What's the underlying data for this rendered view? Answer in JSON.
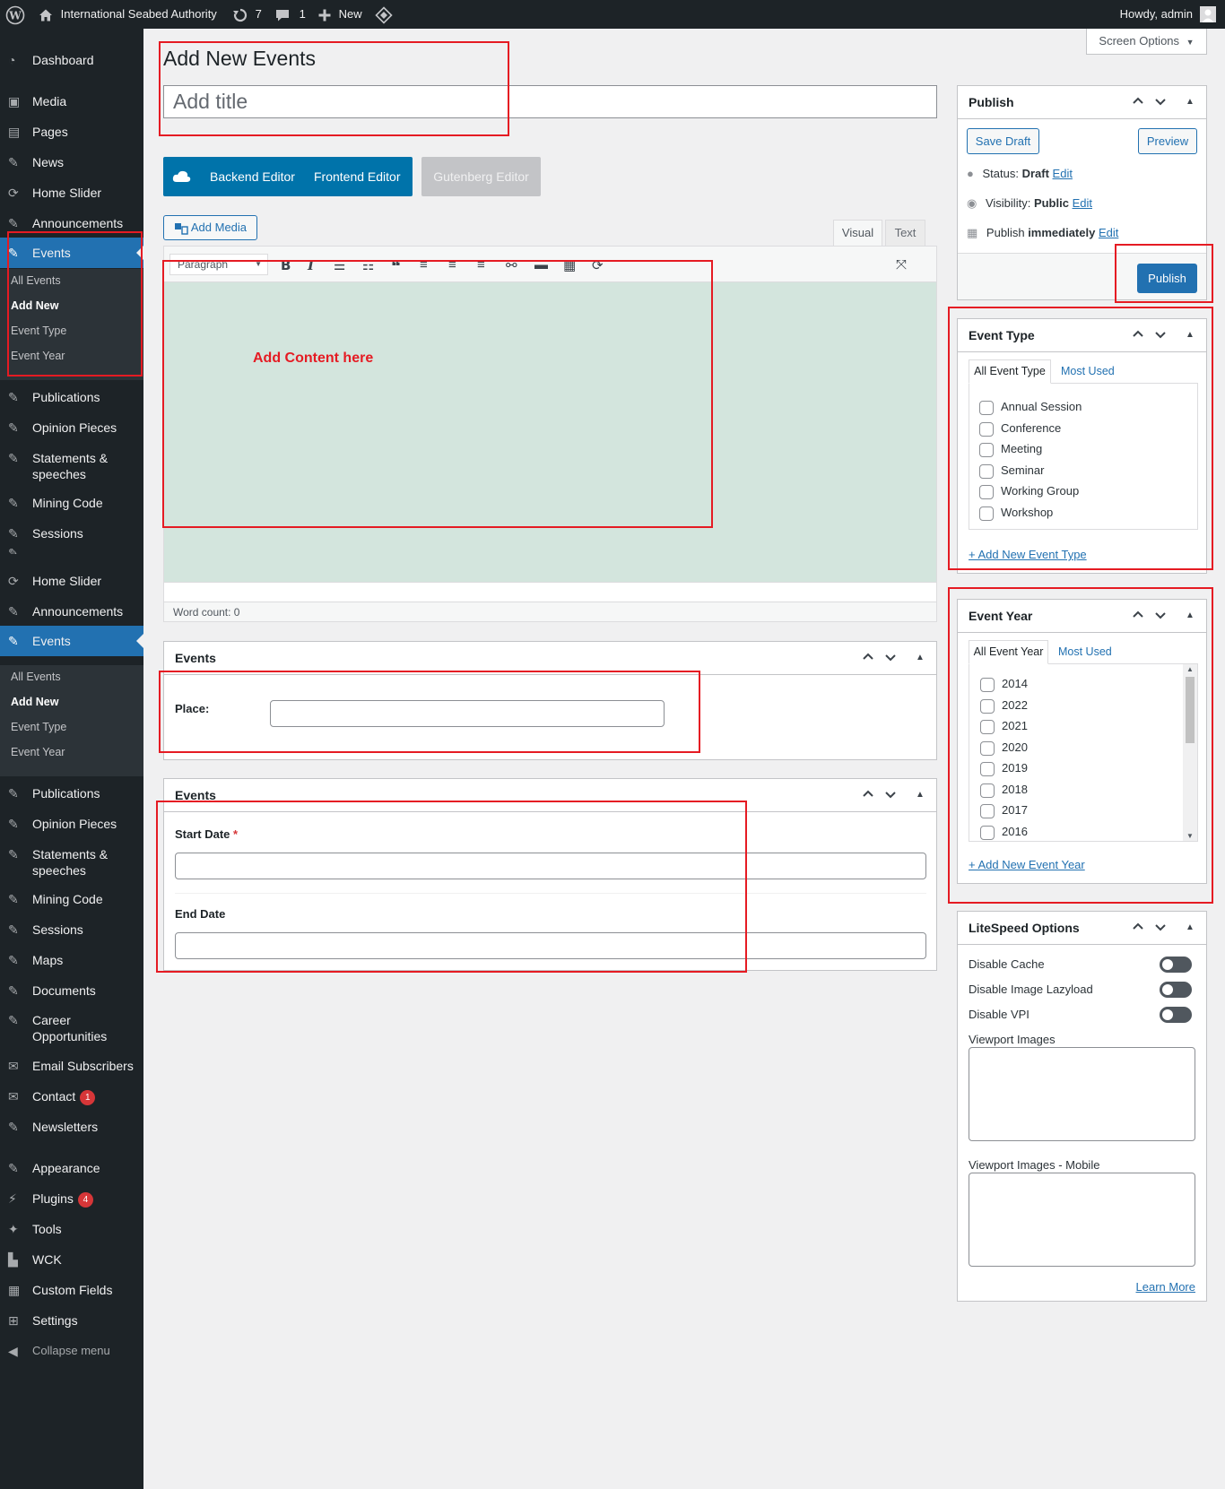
{
  "adminbar": {
    "site_name": "International Seabed Authority",
    "updates_count": "7",
    "comments_count": "1",
    "new_label": "New",
    "howdy": "Howdy, admin"
  },
  "sidebar": {
    "items_top": [
      {
        "label": "Dashboard",
        "icon": "dashboard-icon"
      },
      {
        "label": "Media",
        "icon": "media-icon"
      },
      {
        "label": "Pages",
        "icon": "pages-icon"
      },
      {
        "label": "News",
        "icon": "pin-icon"
      },
      {
        "label": "Home Slider",
        "icon": "slider-icon"
      },
      {
        "label": "Announcements",
        "icon": "pin-icon"
      },
      {
        "label": "Events",
        "icon": "pin-icon"
      }
    ],
    "events_sub": [
      "All Events",
      "Add New",
      "Event Type",
      "Event Year"
    ],
    "items_mid": [
      {
        "label": "Publications"
      },
      {
        "label": "Opinion Pieces"
      },
      {
        "label": "Statements &",
        "label2": "speeches"
      },
      {
        "label": "Mining Code"
      },
      {
        "label": "Sessions"
      }
    ],
    "items_repeat": [
      {
        "label": "Home Slider"
      },
      {
        "label": "Announcements"
      },
      {
        "label": "Events"
      }
    ],
    "items_bottom": [
      {
        "label": "Publications"
      },
      {
        "label": "Opinion Pieces"
      },
      {
        "label": "Statements &",
        "label2": "speeches"
      },
      {
        "label": "Mining Code"
      },
      {
        "label": "Sessions"
      },
      {
        "label": "Maps"
      },
      {
        "label": "Documents"
      },
      {
        "label": "Career",
        "label2": "Opportunities"
      },
      {
        "label": "Email Subscribers"
      },
      {
        "label": "Contact",
        "badge": "1"
      },
      {
        "label": "Newsletters"
      },
      {
        "label": "Appearance"
      },
      {
        "label": "Plugins",
        "badge": "4"
      },
      {
        "label": "Tools"
      },
      {
        "label": "WCK"
      },
      {
        "label": "Custom Fields"
      },
      {
        "label": "Settings"
      },
      {
        "label": "Collapse menu"
      }
    ]
  },
  "screen_options": "Screen Options",
  "page_title": "Add New Events",
  "title_placeholder": "Add title",
  "editor_buttons": {
    "backend": "Backend Editor",
    "frontend": "Frontend Editor",
    "gutenberg": "Gutenberg Editor"
  },
  "add_media": "Add Media",
  "tabs": {
    "visual": "Visual",
    "text": "Text"
  },
  "format_select": "Paragraph",
  "content_annotation": "Add Content here",
  "word_count": "Word count: 0",
  "events_box1": {
    "title": "Events",
    "place_label": "Place:"
  },
  "events_box2": {
    "title": "Events",
    "start_label": "Start Date",
    "required": "*",
    "end_label": "End Date"
  },
  "publish": {
    "title": "Publish",
    "save_draft": "Save Draft",
    "preview": "Preview",
    "status_label": "Status:",
    "status_value": "Draft",
    "visibility_label": "Visibility:",
    "visibility_value": "Public",
    "publish_label": "Publish",
    "publish_value": "immediately",
    "edit": "Edit",
    "publish_button": "Publish"
  },
  "event_type": {
    "title": "Event Type",
    "tab_all": "All Event Type",
    "tab_most": "Most Used",
    "items": [
      "Annual Session",
      "Conference",
      "Meeting",
      "Seminar",
      "Working Group",
      "Workshop"
    ],
    "add_new": "+ Add New Event Type"
  },
  "event_year": {
    "title": "Event Year",
    "tab_all": "All Event Year",
    "tab_most": "Most Used",
    "items": [
      "2014",
      "2022",
      "2021",
      "2020",
      "2019",
      "2018",
      "2017",
      "2016"
    ],
    "add_new": "+ Add New Event Year"
  },
  "litespeed": {
    "title": "LiteSpeed Options",
    "disable_cache": "Disable Cache",
    "disable_lazy": "Disable Image Lazyload",
    "disable_vpi": "Disable VPI",
    "viewport_images": "Viewport Images",
    "viewport_mobile": "Viewport Images - Mobile",
    "learn_more": "Learn More"
  },
  "colors": {
    "accent": "#2271b1",
    "annotation": "#e51b23",
    "editor_bg": "#d3e5dd",
    "sidebar_bg": "#1d2327"
  }
}
